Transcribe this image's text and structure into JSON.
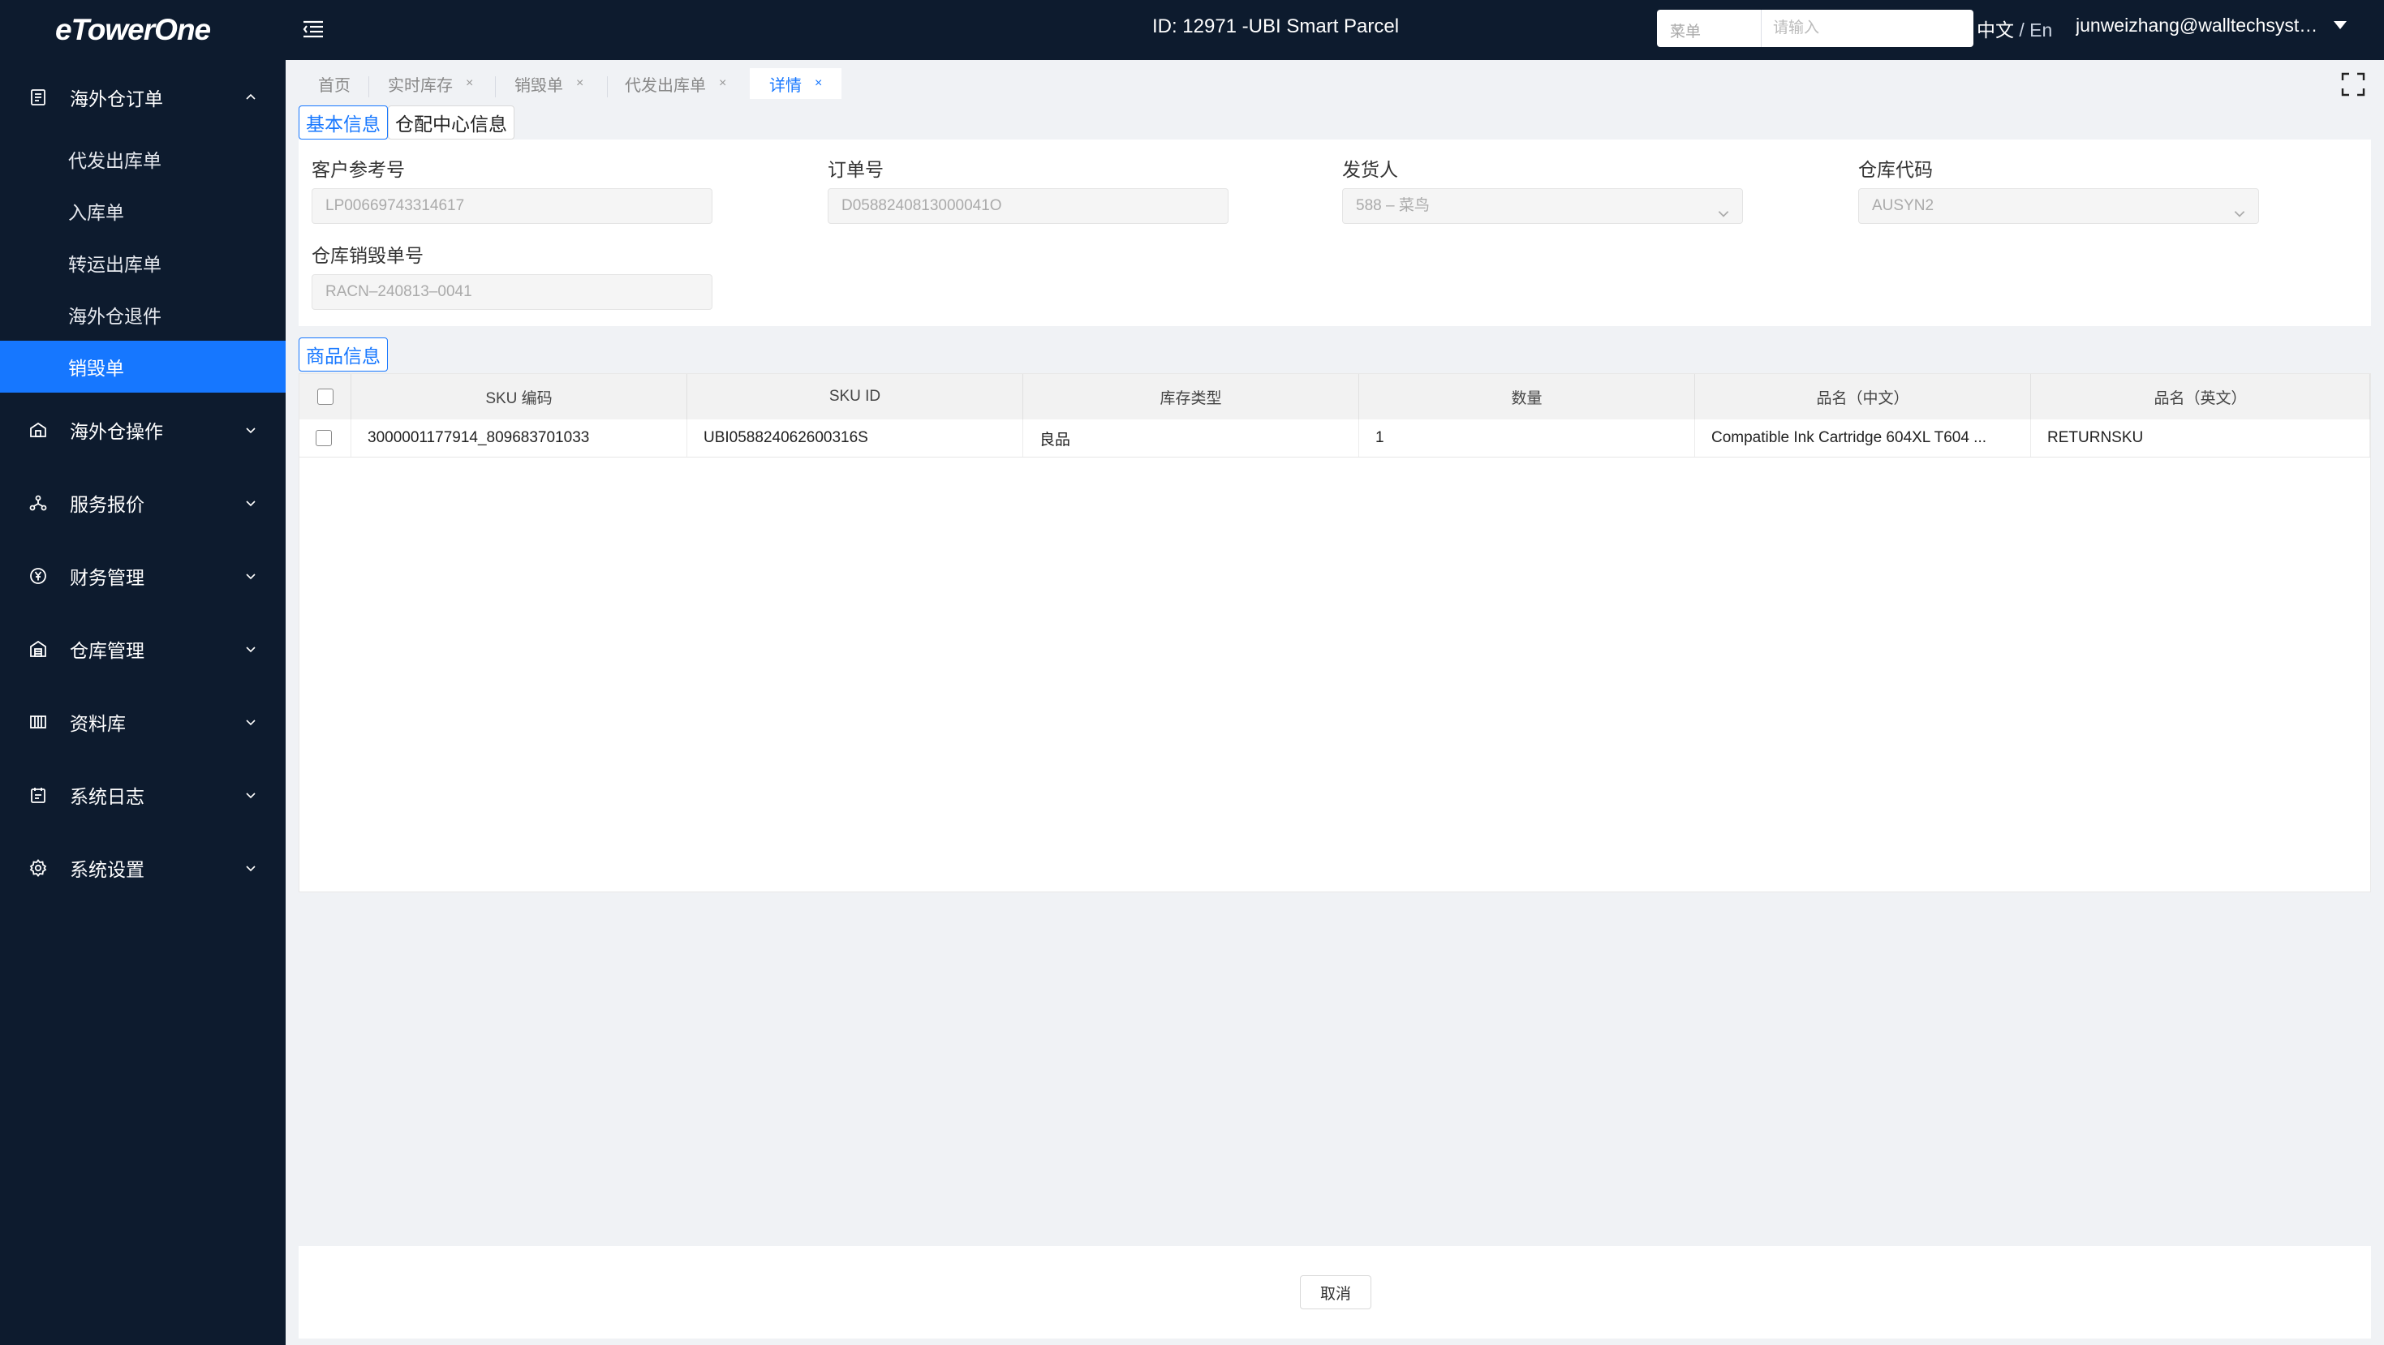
{
  "app": {
    "logo": "eTowerOne",
    "title": "ID: 12971 -UBI Smart Parcel"
  },
  "header": {
    "search": {
      "select_label": "菜单",
      "placeholder": "请输入"
    },
    "lang": {
      "zh": "中文",
      "sep": "/",
      "en": "En"
    },
    "user": "junweizhang@walltechsyste..."
  },
  "sidebar": {
    "groups": [
      {
        "label": "海外仓订单",
        "icon": "order-icon",
        "expanded": true
      },
      {
        "label": "海外仓操作",
        "icon": "warehouse-op-icon"
      },
      {
        "label": "服务报价",
        "icon": "network-icon"
      },
      {
        "label": "财务管理",
        "icon": "yuan-icon"
      },
      {
        "label": "仓库管理",
        "icon": "warehouse-icon"
      },
      {
        "label": "资料库",
        "icon": "library-icon"
      },
      {
        "label": "系统日志",
        "icon": "log-icon"
      },
      {
        "label": "系统设置",
        "icon": "gear-icon"
      }
    ],
    "subitems": [
      {
        "label": "代发出库单"
      },
      {
        "label": "入库单"
      },
      {
        "label": "转运出库单"
      },
      {
        "label": "海外仓退件"
      },
      {
        "label": "销毁单",
        "active": true
      }
    ]
  },
  "tabs": [
    {
      "label": "首页",
      "closable": false
    },
    {
      "label": "实时库存",
      "closable": true
    },
    {
      "label": "销毁单",
      "closable": true
    },
    {
      "label": "代发出库单",
      "closable": true
    },
    {
      "label": "详情",
      "closable": true,
      "active": true
    }
  ],
  "close_glyph": "×",
  "sections": {
    "basic": "基本信息",
    "center": "仓配中心信息",
    "goods": "商品信息"
  },
  "form": {
    "customer_ref": {
      "label": "客户参考号",
      "value": "LP00669743314617"
    },
    "order_no": {
      "label": "订单号",
      "value": "D0588240813000041O"
    },
    "shipper": {
      "label": "发货人",
      "value": "588 – 菜鸟"
    },
    "warehouse_code": {
      "label": "仓库代码",
      "value": "AUSYN2"
    },
    "destroy_no": {
      "label": "仓库销毁单号",
      "value": "RACN–240813–0041"
    }
  },
  "table": {
    "columns": [
      "SKU 编码",
      "SKU ID",
      "库存类型",
      "数量",
      "品名（中文）",
      "品名（英文）"
    ],
    "rows": [
      [
        "3000001177914_809683701033",
        "UBI058824062600316S",
        "良品",
        "1",
        "Compatible Ink Cartridge 604XL T604 ...",
        "RETURNSKU"
      ]
    ]
  },
  "footer": {
    "cancel": "取消"
  },
  "colors": {
    "sidebar_bg": "#0d1b2e",
    "accent": "#1677ff",
    "content_bg": "#f0f2f5"
  }
}
